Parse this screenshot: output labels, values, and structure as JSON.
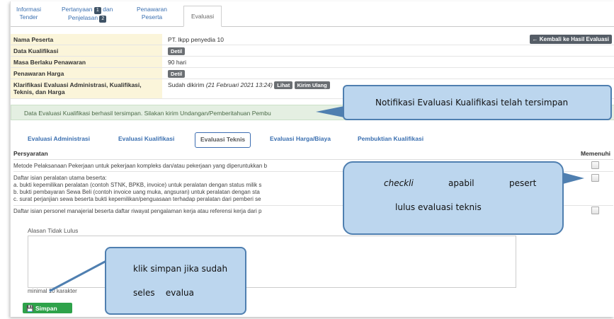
{
  "top_tabs": [
    {
      "line1": "Informasi",
      "line2": "Tender"
    },
    {
      "line1": "Pertanyaan",
      "badge1": "1",
      "line1b": "dan",
      "line2": "Penjelasan",
      "badge2": "2"
    },
    {
      "line1": "Penawaran",
      "line2": "Peserta"
    },
    {
      "line1": "Evaluasi"
    }
  ],
  "info": {
    "nama_label": "Nama Peserta",
    "nama_value": "PT. lkpp penyedia 10",
    "back_button": "← Kembali ke Hasil Evaluasi",
    "kualifikasi_label": "Data Kualifikasi",
    "kualifikasi_btn": "Detil",
    "masa_label": "Masa Berlaku Penawaran",
    "masa_value": "90 hari",
    "harga_label": "Penawaran Harga",
    "harga_btn": "Detil",
    "klarifikasi_label_1": "Klarifikasi Evaluasi Administrasi, Kualifikasi,",
    "klarifikasi_label_2": "Teknis, dan Harga",
    "klarifikasi_status": "Sudah dikirim",
    "klarifikasi_date": "(21 Februari 2021 13:24)",
    "lihat_btn": "Lihat",
    "kirim_btn": "Kirim Ulang"
  },
  "notice": "Data Evaluasi Kualifikasi berhasil tersimpan. Silakan kirim Undangan/Pemberitahuan Pembu",
  "sub_tabs": [
    "Evaluasi Administrasi",
    "Evaluasi Kualifikasi",
    "Evaluasi Teknis",
    "Evaluasi Harga/Biaya",
    "Pembuktian Kualifikasi"
  ],
  "req_header": {
    "persyaratan": "Persyaratan",
    "memenuhi": "Memenuhi"
  },
  "requirements": {
    "r1": "Metode Pelaksanaan Pekerjaan untuk pekerjaan kompleks dan/atau pekerjaan yang diperuntukkan b",
    "r2_l1": "Daftar isian peralatan utama beserta:",
    "r2_l2": "a. bukti kepemilikan peralatan (contoh STNK, BPKB, invoice) untuk peralatan dengan status milik s",
    "r2_l3": "b. bukti pembayaran Sewa Beli (contoh invoice uang muka, angsuran) untuk peralatan dengan sta",
    "r2_l4": "c. surat perjanjian sewa beserta bukti kepemilikan/penguasaan terhadap peralatan dari pemberi se",
    "r3": "Daftar isian personel manajerial beserta daftar riwayat pengalaman kerja atau referensi kerja dari p"
  },
  "alasan_label": "Alasan Tidak Lulus",
  "minimal_text": "minimal 10 karakter",
  "simpan_button": "Simpan",
  "callouts": {
    "notif": "Notifikasi Evaluasi Kualifikasi telah tersimpan",
    "checklist_italic": "checkli",
    "checklist_w2": "apabil",
    "checklist_w3": "pesert",
    "checklist_line2": "lulus evaluasi teknis",
    "simpan_line1": "klik simpan jika sudah",
    "simpan_line2": "seles    evalua"
  },
  "colors": {
    "link": "#3a6fb0",
    "label_bg": "#fbf5da",
    "notice_bg": "#e4efe2",
    "callout_bg": "#bcd6ee",
    "save_green": "#2ea24a"
  }
}
